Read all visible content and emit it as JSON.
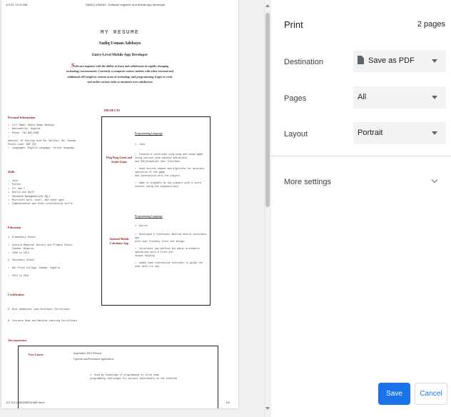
{
  "preview": {
    "header_left": "4/7/23, 12:10 AM",
    "header_center": "SADIQ USMAN - Software engineer and Mobile App developer",
    "footer_left": "127.0.0.1:5500/RESUME.html",
    "footer_right": "1/2",
    "resume": {
      "title": "MY RESUME",
      "name": "Sadiq Usman Adebayo",
      "role": "Entry-Level Mobile App Developer",
      "summary_first": "S",
      "summary_rest": "oftware engineer with the ability to learn and collaborate in rapidly changing technology environments. Currently a computer science student with other external and additional self-taught in various areas of technology and programming. Eager to work and tackle various tasks to maximize user satisfaction",
      "personal_heading": "Personal Information",
      "personal_items": "•  Full Name: Sadiq Usman Adebayo\n•  Nationality: Nigeria\n•  Phone: 782-899-0468\n•\nAddress: 87 Farring cove Rd, Halifax, NS, Canada\nPostal code: B3P 2R2\n•  Languages: English Language, Yoruba language",
      "skills_heading": "Skills",
      "skills_items": "•  Java\n•  Python\n•  C++ and C\n•  Kotlin and Swift\n•  Database Management(My SQL)\n•  Microsoft word, excel, and other apps\n•  Communication and Inter-relationship skills",
      "education_heading": "Education",
      "education_items": "1. Elementary School\n\n•  Sunsola Memorial Nursery and Primary School\n   Ibadan, Nigeria.\n•  2006 to 2013\n\n2. Secondary School\n\n•  Bal-Proud College, Ibadan, Nigeria\n\n•  2013 to 2021",
      "certification_heading": "Certification",
      "certification_items": "A. Ntot Ademeteni Java Developer Certificate\n\n\nB. Coursera Deep and Machine Learning Certificate",
      "job_heading": "Job experience",
      "projects_heading": "PROJECTS",
      "project1": {
        "label": "Ping Pong Game and Snake Game",
        "link": "Programming Language",
        "lang": "1. Java",
        "details": "•  Created a functional ping pong and snake game\nusing various java backend operations\nand GUI(Graphical User Interface.\n\n•  Used various shapes and algorithm for accurate\noperation of the game\nand interaction with the players\n\n•  Game is playable by two players with a score\ncounter using the keyboard keys"
      },
      "project2": {
        "label": "Android Mobile Calculator App",
        "link": "Programming Language",
        "lang": "1. Kotlin",
        "details": "•  Developed a functional Android mobile calculator\napp\nwith user friendly front end design.\n\n•  Calculator can perform the basic arithmetic\noperations with a front end\noutput display.\n\n•  Added some interactive functions to guide the\nuser with its use."
      },
      "job": {
        "title": "Free Lancer",
        "date": "September 2021-Present",
        "subtitle": "Upwork and Freelancer application",
        "details": "1. Used my knowledge of programming to solve some\nprogramming challenges for various individuals on the internet"
      }
    }
  },
  "panel": {
    "title": "Print",
    "page_count": "2 pages",
    "destination_label": "Destination",
    "destination_value": "Save as PDF",
    "pages_label": "Pages",
    "pages_value": "All",
    "layout_label": "Layout",
    "layout_value": "Portrait",
    "more_settings": "More settings",
    "save_label": "Save",
    "cancel_label": "Cancel"
  },
  "colors": {
    "accent": "#1a73e8",
    "heading_red": "#8b1a1a",
    "select_bg": "#f1f3f4"
  }
}
